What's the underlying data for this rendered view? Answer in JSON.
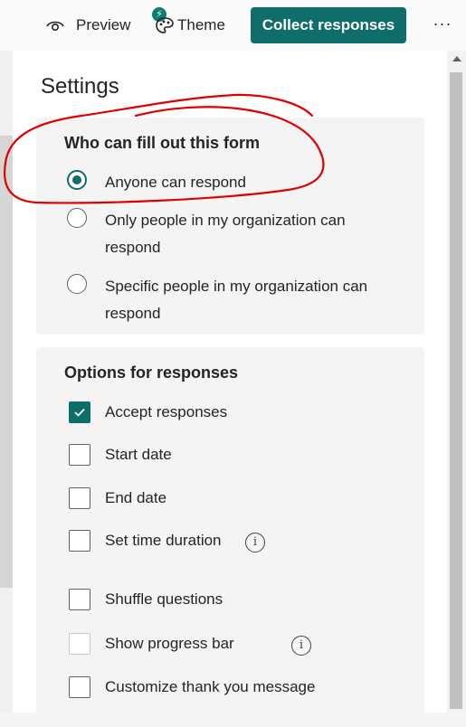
{
  "toolbar": {
    "preview_label": "Preview",
    "theme_label": "Theme",
    "collect_label": "Collect responses",
    "more_label": "···",
    "accent_color": "#0f6d6a"
  },
  "settings": {
    "title": "Settings",
    "who_section": {
      "title": "Who can fill out this form",
      "options": [
        {
          "label": "Anyone can respond",
          "selected": true
        },
        {
          "label": "Only people in my organization can respond",
          "selected": false
        },
        {
          "label": "Specific people in my organization can respond",
          "selected": false
        }
      ]
    },
    "options_section": {
      "title": "Options for responses",
      "items": [
        {
          "label": "Accept responses",
          "checked": true,
          "info": false
        },
        {
          "label": "Start date",
          "checked": false,
          "info": false
        },
        {
          "label": "End date",
          "checked": false,
          "info": false
        },
        {
          "label": "Set time duration",
          "checked": false,
          "info": true
        },
        {
          "label": "Shuffle questions",
          "checked": false,
          "info": false
        },
        {
          "label": "Show progress bar",
          "checked": false,
          "info": true,
          "disabled": true
        },
        {
          "label": "Customize thank you message",
          "checked": false,
          "info": false
        }
      ]
    }
  },
  "icons": {
    "preview": "eye-icon",
    "theme": "palette-icon",
    "more": "more-icon",
    "info": "info-icon"
  },
  "annotation": {
    "color": "#e00000"
  }
}
